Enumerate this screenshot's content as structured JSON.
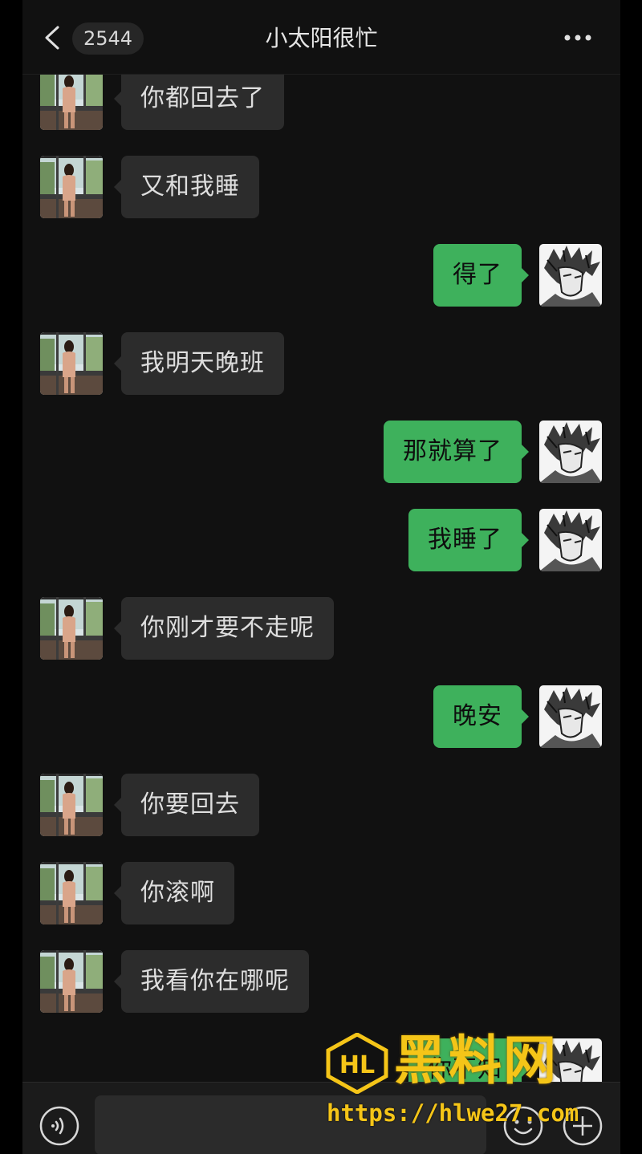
{
  "header": {
    "back_label": "2544",
    "title": "小太阳很忙"
  },
  "messages": [
    {
      "side": "in",
      "text": "你都回去了"
    },
    {
      "side": "in",
      "text": "又和我睡"
    },
    {
      "side": "out",
      "text": "得了"
    },
    {
      "side": "in",
      "text": "我明天晚班"
    },
    {
      "side": "out",
      "text": "那就算了"
    },
    {
      "side": "out",
      "text": "我睡了"
    },
    {
      "side": "in",
      "text": "你刚才要不走呢"
    },
    {
      "side": "out",
      "text": "晚安"
    },
    {
      "side": "in",
      "text": "你要回去"
    },
    {
      "side": "in",
      "text": "你滚啊"
    },
    {
      "side": "in",
      "text": "我看你在哪呢"
    },
    {
      "side": "out",
      "text": "你不知"
    }
  ],
  "input": {
    "value": ""
  },
  "watermark": {
    "title": "黑料网",
    "url": "https://hlwe27.com",
    "emblem_letters": "HL"
  },
  "colors": {
    "background": "#111111",
    "bubble_outgoing": "#3eb15c",
    "bubble_incoming": "#2c2c2c",
    "watermark": "#f5c518"
  },
  "icons": {
    "back": "chevron-left-icon",
    "more": "more-dots-icon",
    "voice": "voice-icon",
    "mic": "mic-icon",
    "emoji": "emoji-icon",
    "add": "plus-icon"
  }
}
